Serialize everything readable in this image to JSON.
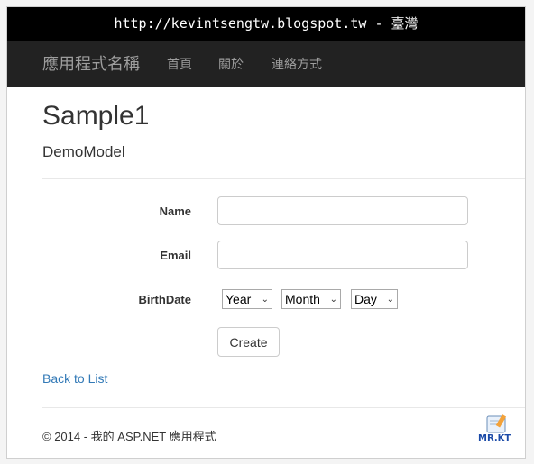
{
  "banner": {
    "text": "http://kevintsengtw.blogspot.tw - 臺灣"
  },
  "navbar": {
    "brand": "應用程式名稱",
    "links": [
      {
        "label": "首頁"
      },
      {
        "label": "關於"
      },
      {
        "label": "連絡方式"
      }
    ]
  },
  "page": {
    "title": "Sample1",
    "subtitle": "DemoModel"
  },
  "form": {
    "name_label": "Name",
    "name_value": "",
    "email_label": "Email",
    "email_value": "",
    "birthdate_label": "BirthDate",
    "year_selected": "Year",
    "month_selected": "Month",
    "day_selected": "Day",
    "create_button": "Create"
  },
  "back_link": "Back to List",
  "footer": {
    "text": "© 2014 - 我的 ASP.NET 應用程式"
  },
  "logo": {
    "text": "MR.KT"
  },
  "colors": {
    "navbar_bg": "#222222",
    "nav_text": "#9d9d9d",
    "link": "#337ab7",
    "banner_bg": "#000000"
  }
}
